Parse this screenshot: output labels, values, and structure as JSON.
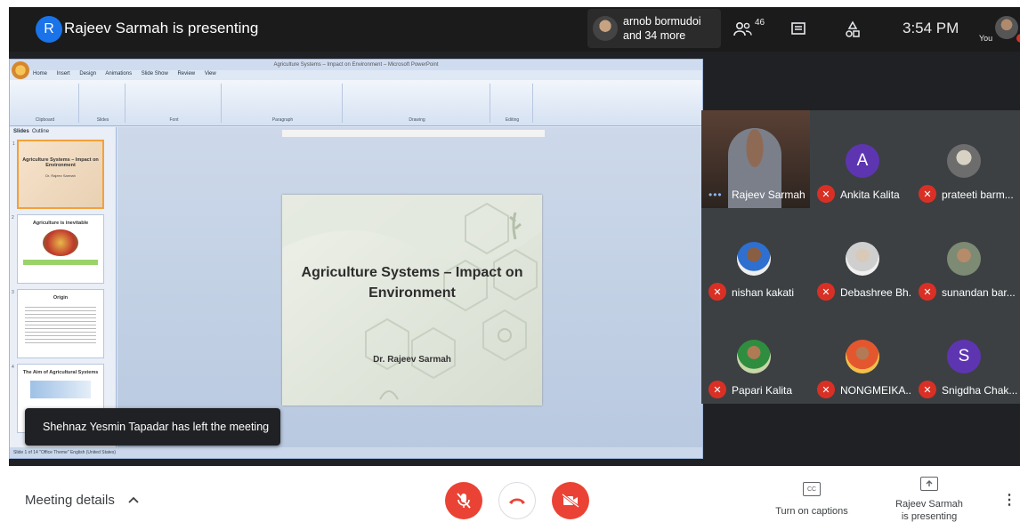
{
  "header": {
    "presenter_initial": "R",
    "presenting_title": "Rajeev Sarmah is presenting",
    "viewers_line1": "arnob bormudoi",
    "viewers_line2": "and 34 more",
    "people_count": "46",
    "time": "3:54 PM",
    "you_label": "You"
  },
  "presentation": {
    "window_title": "Agriculture Systems – Impact on Environment – Microsoft PowerPoint",
    "ribbon_tabs": [
      "Home",
      "Insert",
      "Design",
      "Animations",
      "Slide Show",
      "Review",
      "View"
    ],
    "ribbon_groups": [
      "Clipboard",
      "Slides",
      "Font",
      "Paragraph",
      "Drawing",
      "Editing"
    ],
    "pane_tabs": [
      "Slides",
      "Outline"
    ],
    "thumbnails": [
      {
        "num": "1",
        "title": "Agriculture Systems – Impact on Environment",
        "sub": "Dr. Rajeev Sarmah"
      },
      {
        "num": "2",
        "title": "Agriculture is inevitable",
        "sub": ""
      },
      {
        "num": "3",
        "title": "Origin",
        "sub": ""
      },
      {
        "num": "4",
        "title": "The Aim of Agricultural Systems",
        "sub": ""
      }
    ],
    "status_text": "Slide 1 of 14   \"Office Theme\"   English (United States)",
    "slide_title": "Agriculture Systems – Impact on Environment",
    "slide_author": "Dr. Rajeev Sarmah"
  },
  "toast": "Shehnaz Yesmin Tapadar has left the meeting",
  "participants": [
    {
      "name": "Rajeev Sarmah",
      "type": "video",
      "muted": false
    },
    {
      "name": "Ankita Kalita",
      "type": "initial",
      "initial": "A",
      "color": "#5e35b1",
      "muted": true
    },
    {
      "name": "prateeti barm...",
      "type": "photo",
      "muted": true
    },
    {
      "name": "nishan kakati",
      "type": "photo",
      "muted": true
    },
    {
      "name": "Debashree Bh...",
      "type": "photo",
      "muted": true
    },
    {
      "name": "sunandan bar...",
      "type": "photo",
      "muted": true
    },
    {
      "name": "Papari Kalita",
      "type": "photo",
      "muted": true
    },
    {
      "name": "NONGMEIKA...",
      "type": "photo",
      "muted": true
    },
    {
      "name": "Snigdha Chak...",
      "type": "initial",
      "initial": "S",
      "color": "#5e35b1",
      "muted": true
    }
  ],
  "bottom": {
    "meeting_details": "Meeting details",
    "captions_label": "Turn on captions",
    "present_line1": "Rajeev Sarmah",
    "present_line2": "is presenting"
  },
  "colors": {
    "accent_red": "#ea4335",
    "presenter_blue": "#1a73e8",
    "tile_bg": "#3c4043"
  }
}
